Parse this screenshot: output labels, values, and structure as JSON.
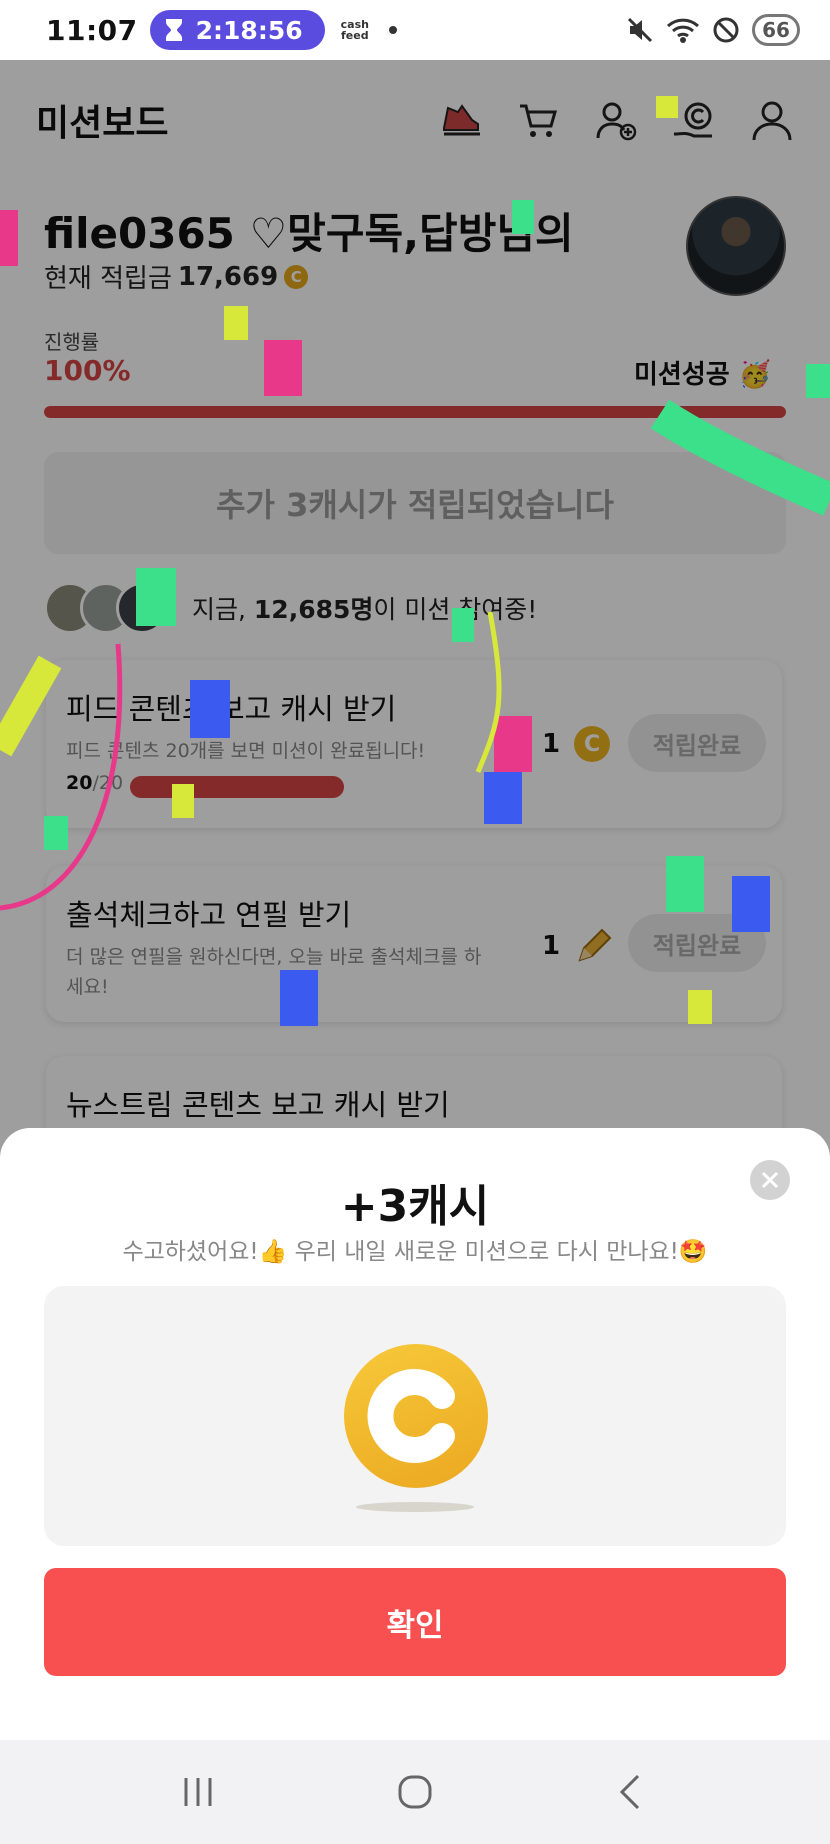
{
  "status_bar": {
    "time": "11:07",
    "timer": "2:18:56",
    "app_label_line1": "cash",
    "app_label_line2": "feed",
    "battery": "66"
  },
  "header": {
    "title": "미션보드",
    "icons": [
      "sneaker-icon",
      "cart-icon",
      "add-friend-icon",
      "cash-hand-icon",
      "profile-icon"
    ]
  },
  "profile": {
    "name": "file0365 ♡맞구독,답방님의",
    "points_label": "현재 적립금",
    "points_value": "17,669",
    "coin_glyph": "C"
  },
  "progress": {
    "label": "진행률",
    "value": "100%",
    "fraction": 1.0,
    "status": "미션성공 🥳"
  },
  "reward_banner": "추가 3캐시가 적립되었습니다",
  "participants": {
    "prefix": "지금, ",
    "count": "12,685명",
    "suffix": "이 미션 참여중!"
  },
  "missions": [
    {
      "title": "피드 콘텐츠 보고 캐시 받기",
      "desc": "피드 콘텐츠 20개를 보면 미션이 완료됩니다!",
      "count_done": "20",
      "count_total": "/20",
      "reward_amount": "1",
      "reward_icon": "coin-icon",
      "button": "적립완료"
    },
    {
      "title": "출석체크하고 연필 받기",
      "desc": "더 많은 연필을 원하신다면, 오늘 바로 출석체크를 하세요!",
      "reward_amount": "1",
      "reward_icon": "pencil-icon",
      "button": "적립완료"
    },
    {
      "title": "뉴스트림 콘텐츠 보고 캐시 받기"
    }
  ],
  "sheet": {
    "title": "+3캐시",
    "subtitle": "수고하셨어요!👍 우리 내일 새로운 미션으로 다시 만나요!🤩",
    "confirm": "확인"
  },
  "colors": {
    "accent_red": "#f85050",
    "progress_red": "#d64545",
    "timer_purple": "#5b4ce0",
    "coin_gold": "#eeb420"
  }
}
